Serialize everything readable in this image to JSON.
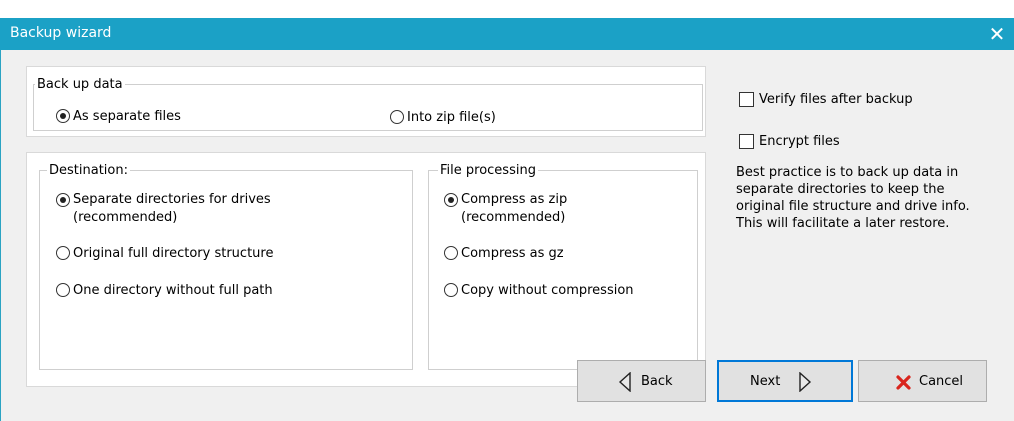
{
  "window": {
    "title": "Backup wizard",
    "close_glyph": "✕"
  },
  "backup_data": {
    "legend": "Back up data",
    "options": [
      {
        "label": "As separate files",
        "selected": true
      },
      {
        "label": "Into zip file(s)",
        "selected": false
      }
    ]
  },
  "destination": {
    "legend": "Destination:",
    "options": [
      {
        "label_line1": "Separate directories for drives",
        "label_line2": "(recommended)",
        "selected": true
      },
      {
        "label": "Original full directory structure",
        "selected": false
      },
      {
        "label": "One directory without full path",
        "selected": false
      }
    ]
  },
  "file_processing": {
    "legend": "File processing",
    "options": [
      {
        "label_line1": "Compress as zip",
        "label_line2": "(recommended)",
        "selected": true
      },
      {
        "label": "Compress as gz",
        "selected": false
      },
      {
        "label": "Copy without compression",
        "selected": false
      }
    ]
  },
  "checks": [
    {
      "label": "Verify files after backup",
      "checked": false
    },
    {
      "label": "Encrypt files",
      "checked": false
    }
  ],
  "description": "Best practice is to back up data in separate directories to keep the original file structure and drive info. This will facilitate a later restore.",
  "buttons": {
    "back": "Back",
    "next": "Next",
    "cancel": "Cancel"
  },
  "icons": {
    "back": "triangle-left-icon",
    "next": "triangle-right-icon",
    "cancel": "red-x-icon"
  },
  "colors": {
    "titlebar": "#1ba1c6",
    "focus_border": "#0078d7",
    "cancel_x": "#d9251d"
  }
}
